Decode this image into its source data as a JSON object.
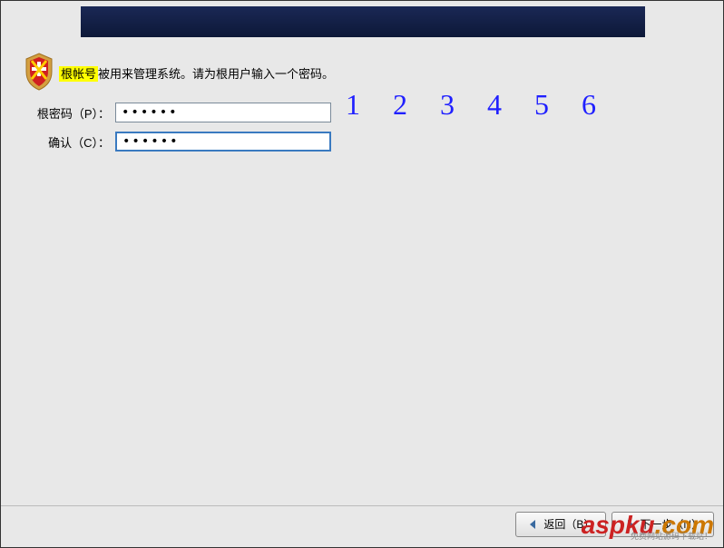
{
  "instruction": {
    "highlighted": "根帐号",
    "rest": "被用来管理系统。请为根用户输入一个密码。"
  },
  "form": {
    "password_label": "根密码（P）：",
    "password_value": "••••••",
    "confirm_label": "确认（C）：",
    "confirm_value": "••••••"
  },
  "handwriting_annotation": "1 2 3 4 5 6",
  "footer": {
    "back_label": "返回（B）",
    "next_label": "下一步（N）"
  },
  "watermark": {
    "red": "aspku",
    "orange": ".com",
    "sub": "免费网站源码下载站！"
  }
}
